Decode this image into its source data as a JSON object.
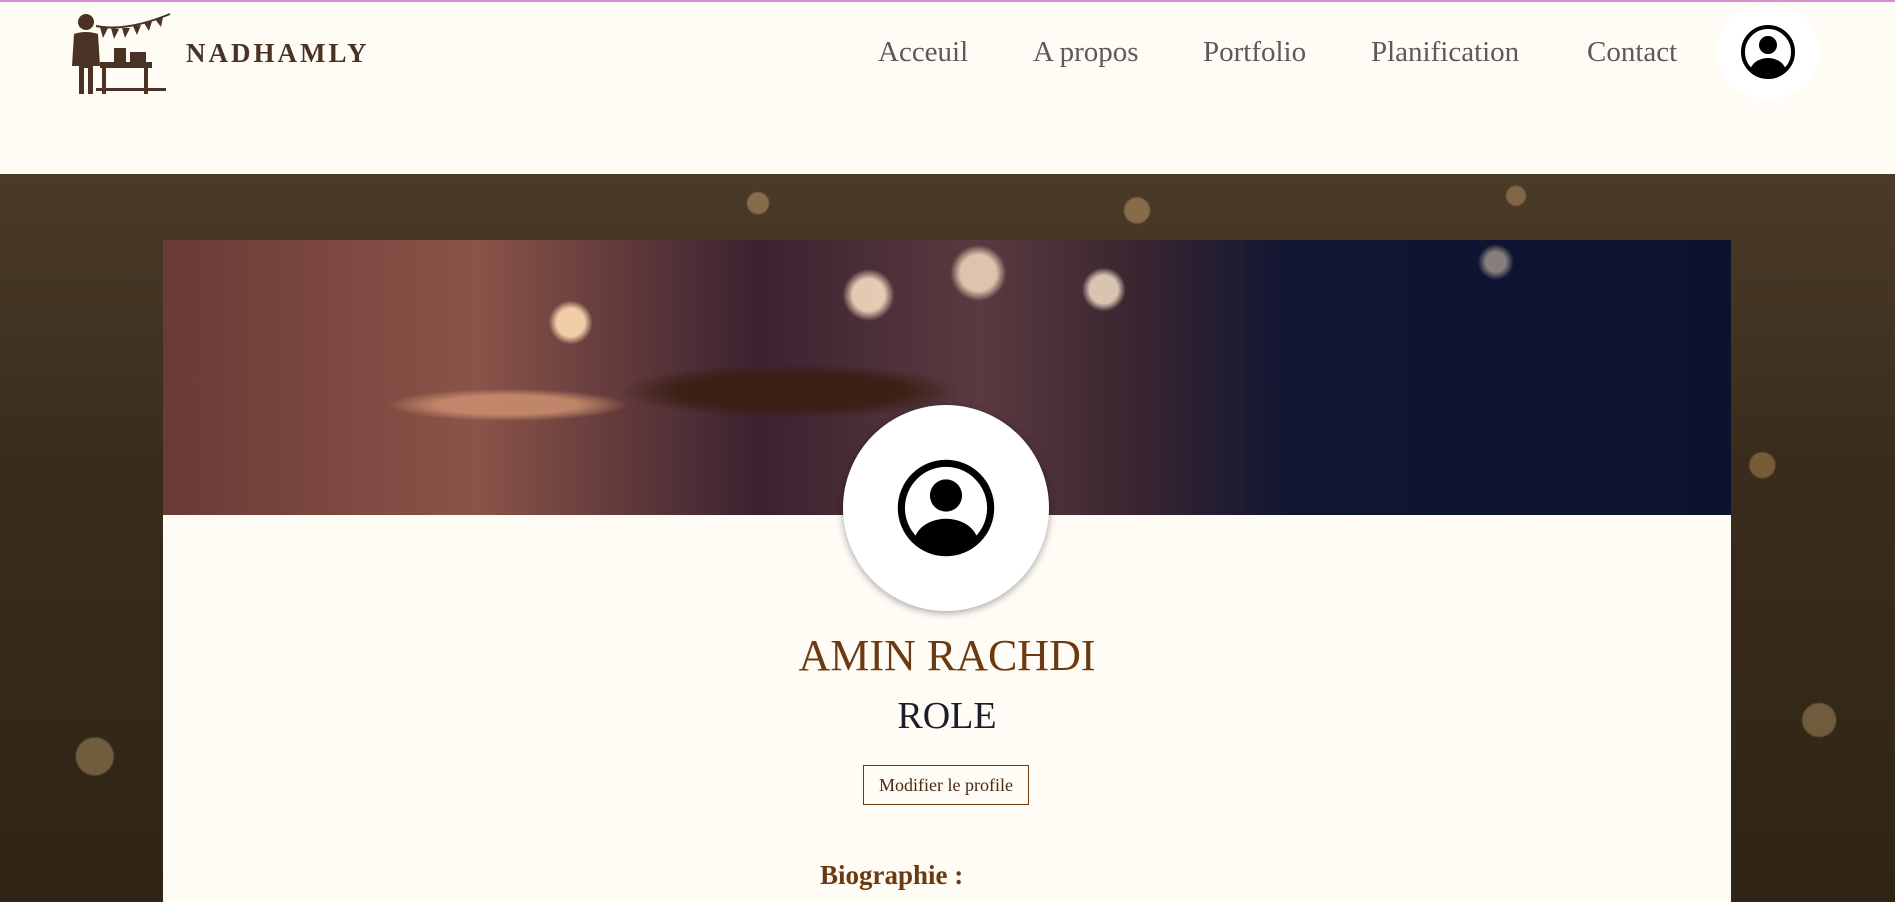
{
  "brand": {
    "name": "NADHAMLY",
    "logo_icon": "wedding-planner-icon"
  },
  "nav": {
    "items": [
      {
        "label": "Acceuil"
      },
      {
        "label": "A propos"
      },
      {
        "label": "Portfolio"
      },
      {
        "label": "Planification"
      },
      {
        "label": "Contact"
      }
    ],
    "account_icon": "user-avatar-icon"
  },
  "profile": {
    "name": "AMIN RACHDI",
    "role": "ROLE",
    "edit_label": "Modifier le profile",
    "bio_label": "Biographie :",
    "avatar_icon": "user-avatar-icon"
  },
  "colors": {
    "accent": "#6b3a12",
    "top_line": "#d98fcf",
    "background": "#fffbf5"
  }
}
